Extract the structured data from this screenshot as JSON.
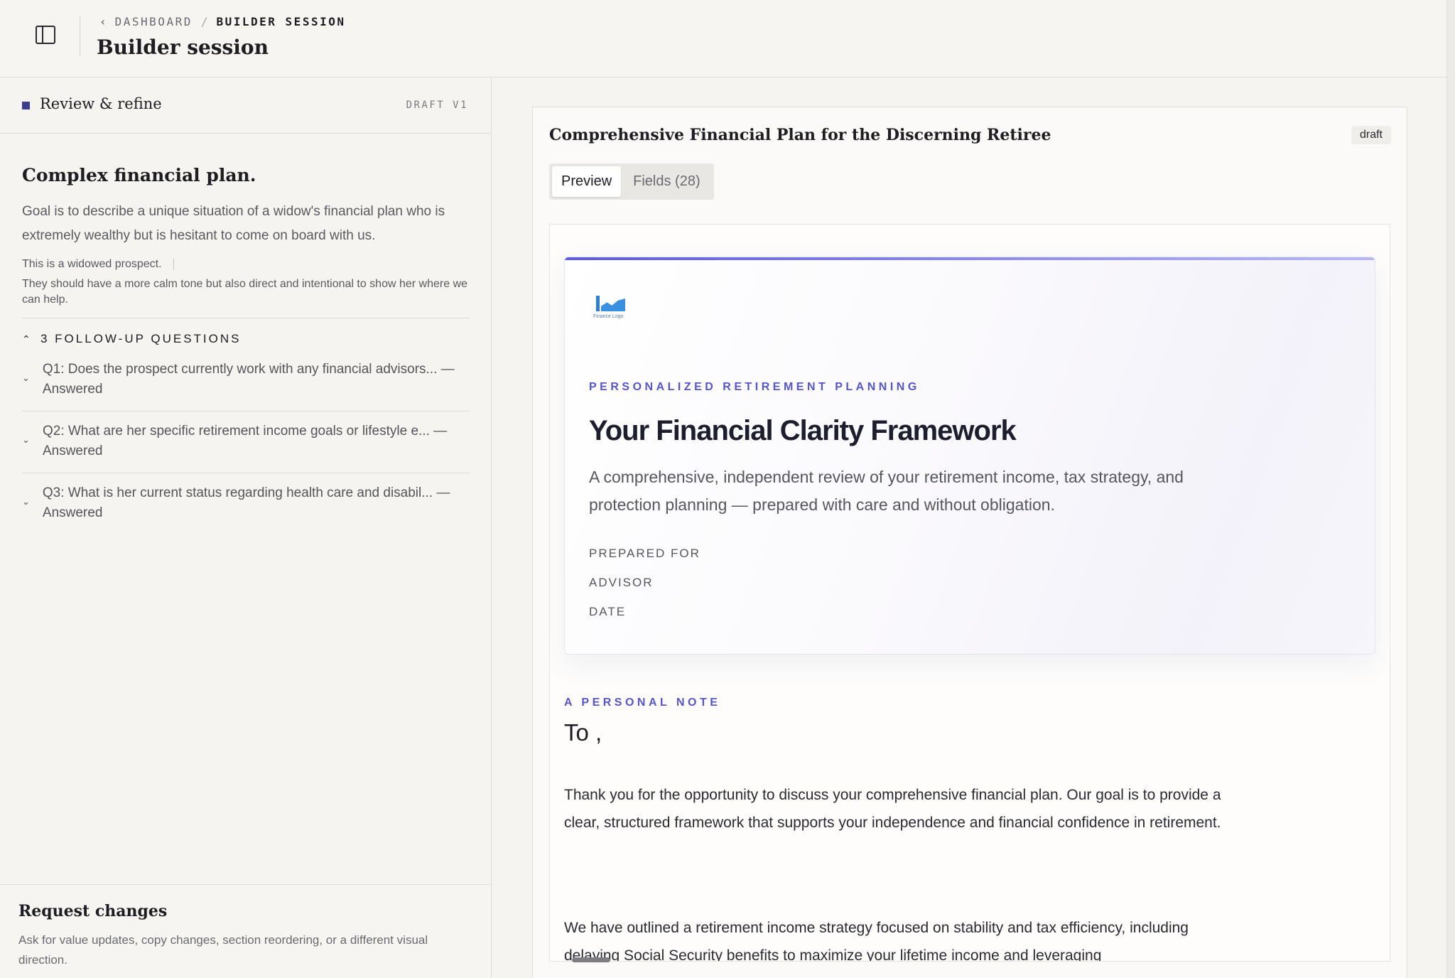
{
  "header": {
    "breadcrumb_parent": "DASHBOARD",
    "breadcrumb_sep": "/",
    "breadcrumb_current": "BUILDER SESSION",
    "title": "Builder session"
  },
  "left": {
    "panel_title": "Review & refine",
    "version": "DRAFT V1",
    "brief_title": "Complex financial plan.",
    "goal": "Goal is to describe a unique situation of a widow's financial plan who is extremely wealthy but is hesitant to come on board with us.",
    "note1": "This is a widowed prospect.",
    "note2": "They should have a more calm tone but also direct and intentional to show her where we can help.",
    "followup_label": "3 FOLLOW-UP QUESTIONS",
    "questions": [
      {
        "text": "Q1: Does the prospect currently work with any financial advisors... — Answered"
      },
      {
        "text": "Q2: What are her specific retirement income goals or lifestyle e... — Answered"
      },
      {
        "text": "Q3: What is her current status regarding health care and disabil... — Answered"
      }
    ],
    "request_title": "Request changes",
    "request_hint": "Ask for value updates, copy changes, section reordering, or a different visual direction."
  },
  "document": {
    "title": "Comprehensive Financial Plan for the Discerning Retiree",
    "status": "draft",
    "tabs": {
      "preview": "Preview",
      "fields": "Fields (28)"
    },
    "logo_caption": "Finance Logo",
    "eyebrow": "PERSONALIZED RETIREMENT PLANNING",
    "headline": "Your Financial Clarity Framework",
    "subheading": "A comprehensive, independent review of your retirement income, tax strategy, and protection planning — prepared with care and without obligation.",
    "meta": {
      "prepared_for": "PREPARED FOR",
      "advisor": "ADVISOR",
      "date": "DATE"
    },
    "note_eyebrow": "A PERSONAL NOTE",
    "note_to": "To ,",
    "note_p1": "Thank you for the opportunity to discuss your comprehensive financial plan. Our goal is to provide a clear, structured framework that supports your independence and financial confidence in retirement.",
    "note_p2": "We have outlined a retirement income strategy focused on stability and tax efficiency, including delaying Social Security benefits to maximize your lifetime income and leveraging"
  },
  "colors": {
    "accent": "#5656c8",
    "marker": "#3d3d8f",
    "background": "#f5f4f0"
  }
}
